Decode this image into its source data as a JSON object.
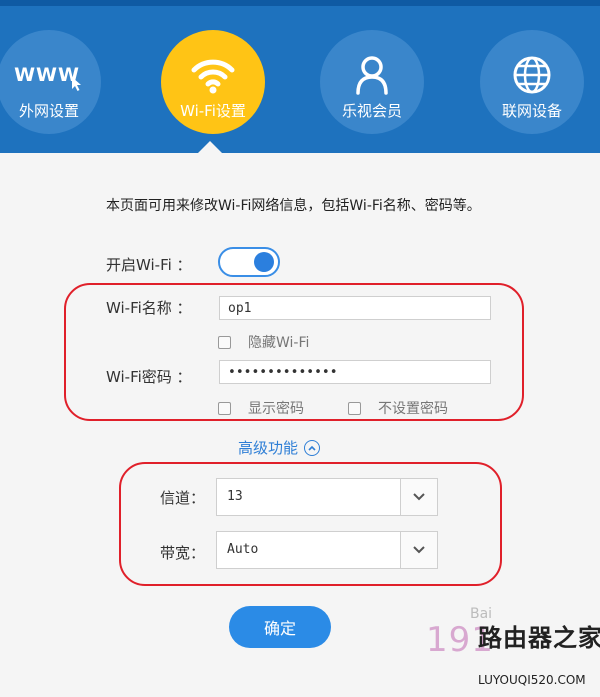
{
  "nav": {
    "items": [
      {
        "label": "外网设置",
        "icon_text": "WWW",
        "icon": "www-cursor-icon",
        "active": false
      },
      {
        "label": "Wi-Fi设置",
        "icon": "wifi-icon",
        "active": true
      },
      {
        "label": "乐视会员",
        "icon": "user-icon",
        "active": false
      },
      {
        "label": "联网设备",
        "icon": "globe-icon",
        "active": false
      }
    ]
  },
  "form": {
    "description": "本页面可用来修改Wi-Fi网络信息，包括Wi-Fi名称、密码等。",
    "wifi_toggle_label": "开启Wi-Fi ：",
    "wifi_enabled": true,
    "ssid_label": "Wi-Fi名称 ：",
    "ssid_value": "op1",
    "hide_wifi_label": "隐藏Wi-Fi",
    "password_label": "Wi-Fi密码 ：",
    "password_value": "••••••••••••••",
    "show_password_label": "显示密码",
    "no_password_label": "不设置密码",
    "advanced_label": "高级功能",
    "channel_label": "信道：",
    "channel_value": "13",
    "bandwidth_label": "带宽：",
    "bandwidth_value": "Auto",
    "confirm_label": "确定"
  },
  "watermark": {
    "left_text": "191",
    "baidu_text": "Bai",
    "brand_text": "路由器之家",
    "site_text": "LUYOUQI520.COM"
  },
  "colors": {
    "header_bg": "#1e72be",
    "nav_circle": "#3a86cb",
    "nav_active": "#ffc415",
    "accent": "#2b8be6",
    "annotation": "#e0202a"
  }
}
